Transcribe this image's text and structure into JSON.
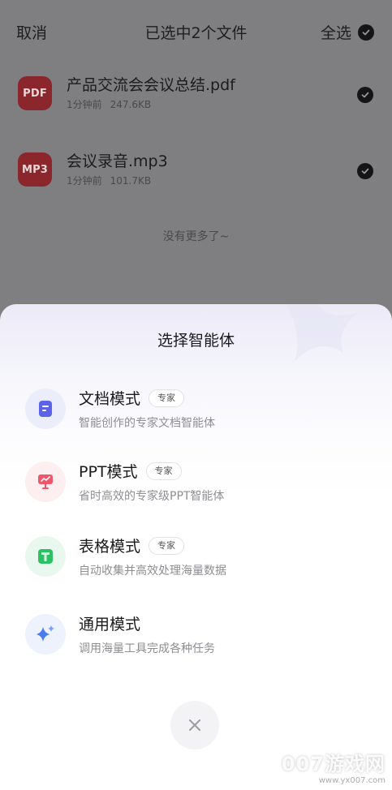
{
  "header": {
    "cancel": "取消",
    "title": "已选中2个文件",
    "select_all": "全选"
  },
  "files": [
    {
      "icon_label": "PDF",
      "name": "产品交流会会议总结.pdf",
      "time": "1分钟前",
      "size": "247.6KB",
      "selected": true
    },
    {
      "icon_label": "MP3",
      "name": "会议录音.mp3",
      "time": "1分钟前",
      "size": "101.7KB",
      "selected": true
    }
  ],
  "no_more": "没有更多了~",
  "sheet": {
    "title": "选择智能体",
    "modes": [
      {
        "name": "文档模式",
        "badge": "专家",
        "desc": "智能创作的专家文档智能体",
        "icon": "document-icon",
        "color": "#5b63e8"
      },
      {
        "name": "PPT模式",
        "badge": "专家",
        "desc": "省时高效的专家级PPT智能体",
        "icon": "presentation-icon",
        "color": "#f0566a"
      },
      {
        "name": "表格模式",
        "badge": "专家",
        "desc": "自动收集并高效处理海量数据",
        "icon": "table-icon",
        "color": "#2ec065"
      },
      {
        "name": "通用模式",
        "badge": "",
        "desc": "调用海量工具完成各种任务",
        "icon": "sparkle-icon",
        "color": "#4a7cf0"
      }
    ]
  },
  "watermark": {
    "big": "007游戏网",
    "small": "www.yx007.com"
  }
}
